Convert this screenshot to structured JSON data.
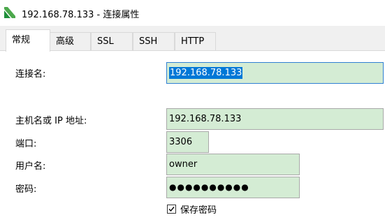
{
  "window": {
    "title": "192.168.78.133 - 连接属性"
  },
  "tabs": [
    {
      "label": "常规",
      "active": true
    },
    {
      "label": "高级",
      "active": false
    },
    {
      "label": "SSL",
      "active": false
    },
    {
      "label": "SSH",
      "active": false
    },
    {
      "label": "HTTP",
      "active": false
    }
  ],
  "form": {
    "connection_name": {
      "label": "连接名:",
      "value": "192.168.78.133"
    },
    "host": {
      "label": "主机名或 IP 地址:",
      "value": "192.168.78.133"
    },
    "port": {
      "label": "端口:",
      "value": "3306"
    },
    "username": {
      "label": "用户名:",
      "value": "owner"
    },
    "password": {
      "label": "密码:",
      "value": "●●●●●●●●●●"
    },
    "save_password": {
      "label": "保存密码",
      "checked": true
    }
  },
  "colors": {
    "field_bg": "#d4ecd4",
    "selection": "#0078d7",
    "focus_border": "#2f7fd3",
    "app_icon": "#4ca84c"
  }
}
